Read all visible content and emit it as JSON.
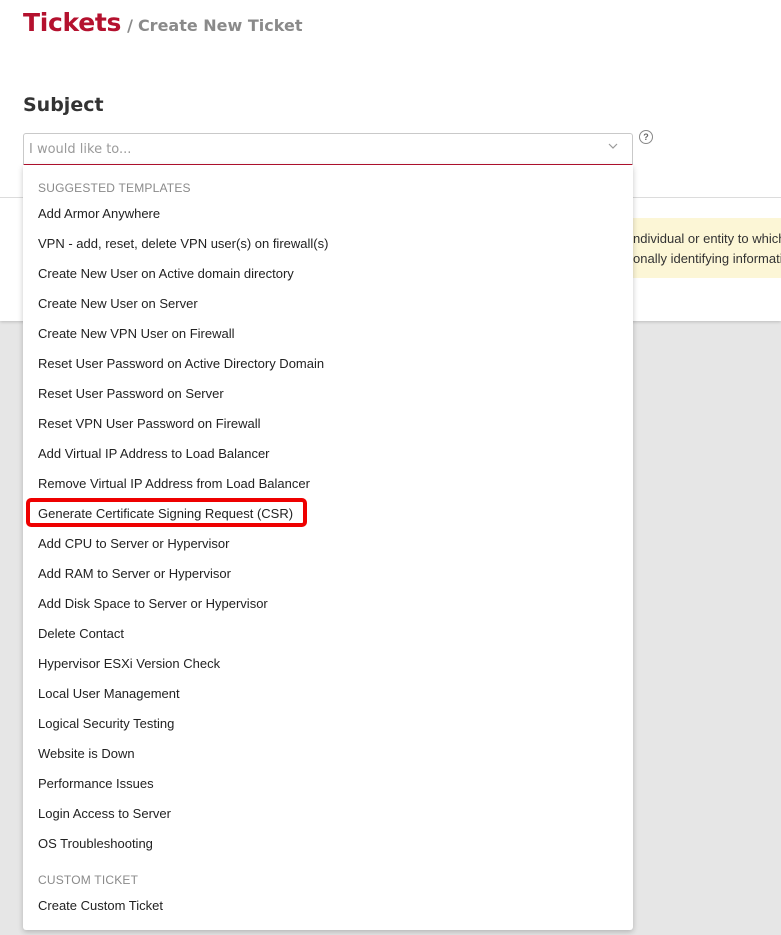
{
  "header": {
    "title": "Tickets",
    "separator": "/",
    "crumb": "Create New Ticket"
  },
  "form": {
    "subject_label": "Subject",
    "select_placeholder": "I would like to...",
    "help_symbol": "?"
  },
  "notice": {
    "line1": "ndividual or entity to which",
    "line2": "onally identifying informatio"
  },
  "dropdown": {
    "suggested_header": "SUGGESTED TEMPLATES",
    "suggested": [
      "Add Armor Anywhere",
      "VPN - add, reset, delete VPN user(s) on firewall(s)",
      "Create New User on Active domain directory",
      "Create New User on Server",
      "Create New VPN User on Firewall",
      "Reset User Password on Active Directory Domain",
      "Reset User Password on Server",
      "Reset VPN User Password on Firewall",
      "Add Virtual IP Address to Load Balancer",
      "Remove Virtual IP Address from Load Balancer",
      "Generate Certificate Signing Request (CSR)",
      "Add CPU to Server or Hypervisor",
      "Add RAM to Server or Hypervisor",
      "Add Disk Space to Server or Hypervisor",
      "Delete Contact",
      "Hypervisor ESXi Version Check",
      "Local User Management",
      "Logical Security Testing",
      "Website is Down",
      "Performance Issues",
      "Login Access to Server",
      "OS Troubleshooting"
    ],
    "custom_header": "CUSTOM TICKET",
    "custom": [
      "Create Custom Ticket"
    ],
    "highlighted_item": "Generate Certificate Signing Request (CSR)"
  },
  "colors": {
    "brand_red": "#b4112e",
    "highlight_red": "#ee0000",
    "notice_bg": "#fcf6d6"
  },
  "icons": {
    "select_arrow": "chevron-down-icon",
    "help": "help-icon"
  }
}
